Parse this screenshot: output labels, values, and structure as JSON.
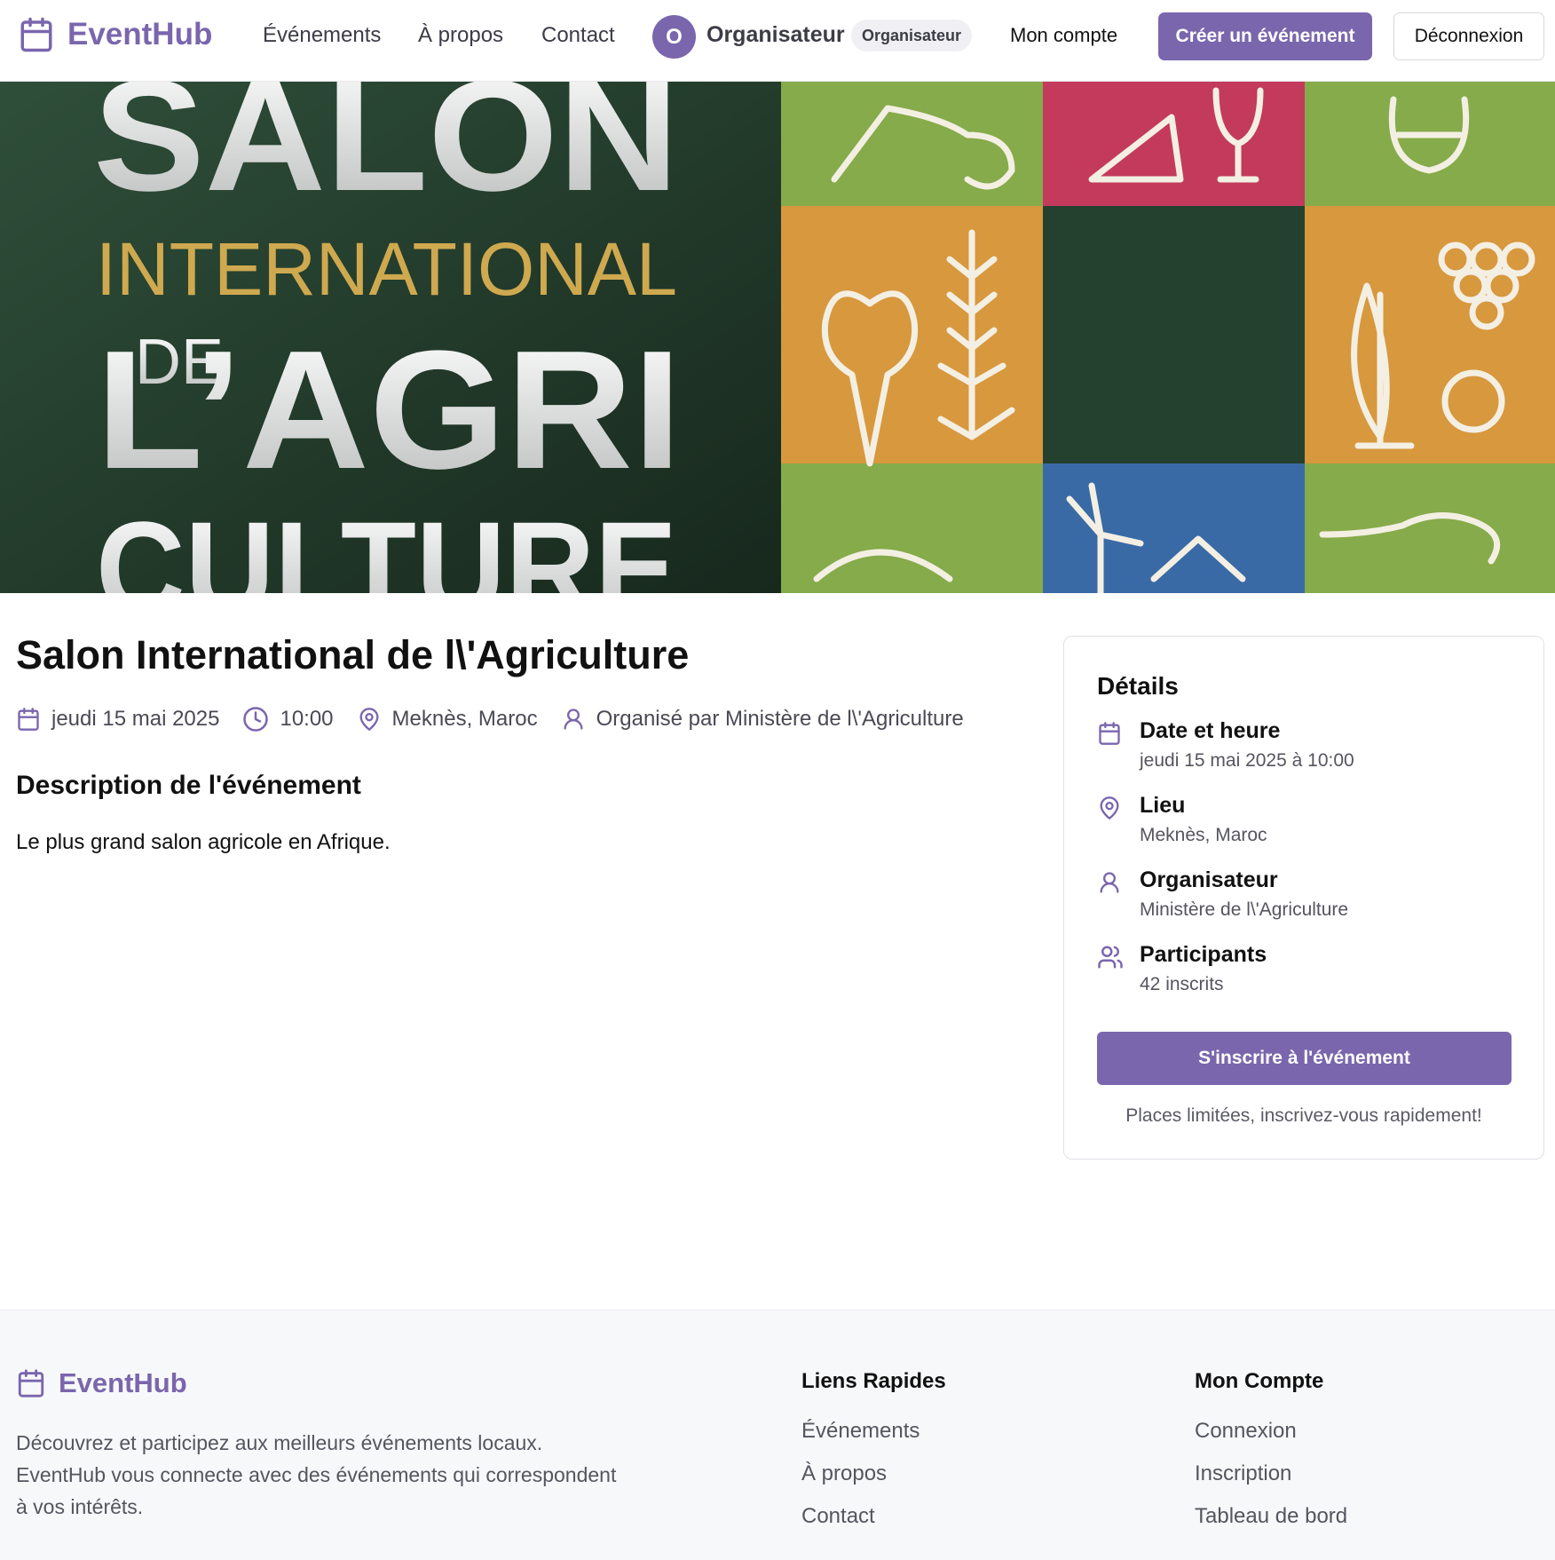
{
  "header": {
    "brand": "EventHub",
    "nav": [
      "Événements",
      "À propos",
      "Contact"
    ],
    "user": {
      "initial": "O",
      "name": "Organisateur",
      "role": "Organisateur"
    },
    "account_link": "Mon compte",
    "create_button": "Créer un événement",
    "logout_button": "Déconnexion"
  },
  "hero": {
    "line1": "SALON",
    "line2": "INTERNATIONAL",
    "line3_small": "DE",
    "line3": "L’AGRI",
    "line4": "CULTURE"
  },
  "event": {
    "title": "Salon International de l\\'Agriculture",
    "date": "jeudi 15 mai 2025",
    "time": "10:00",
    "location": "Meknès, Maroc",
    "organizer_line": "Organisé par Ministère de l\\'Agriculture",
    "description_heading": "Description de l'événement",
    "description": "Le plus grand salon agricole en Afrique."
  },
  "details": {
    "title": "Détails",
    "items": [
      {
        "icon": "calendar-icon",
        "label": "Date et heure",
        "value": "jeudi 15 mai 2025 à 10:00"
      },
      {
        "icon": "map-pin-icon",
        "label": "Lieu",
        "value": "Meknès, Maroc"
      },
      {
        "icon": "user-icon",
        "label": "Organisateur",
        "value": "Ministère de l\\'Agriculture"
      },
      {
        "icon": "users-icon",
        "label": "Participants",
        "value": "42 inscrits"
      }
    ],
    "register_button": "S'inscrire à l'événement",
    "note": "Places limitées, inscrivez-vous rapidement!"
  },
  "footer": {
    "brand": "EventHub",
    "description": "Découvrez et participez aux meilleurs événements locaux. EventHub vous connecte avec des événements qui correspondent à vos intérêts.",
    "quick_links": {
      "title": "Liens Rapides",
      "links": [
        "Événements",
        "À propos",
        "Contact"
      ]
    },
    "account": {
      "title": "Mon Compte",
      "links": [
        "Connexion",
        "Inscription",
        "Tableau de bord"
      ]
    }
  },
  "colors": {
    "accent": "#7a66ad",
    "hero_dark_green": "#24412f",
    "hero_gold": "#cfa94f",
    "tile_green": "#86ab4a",
    "tile_red": "#c33a5c",
    "tile_orange": "#d7983e",
    "tile_blue": "#3a6aa6"
  }
}
